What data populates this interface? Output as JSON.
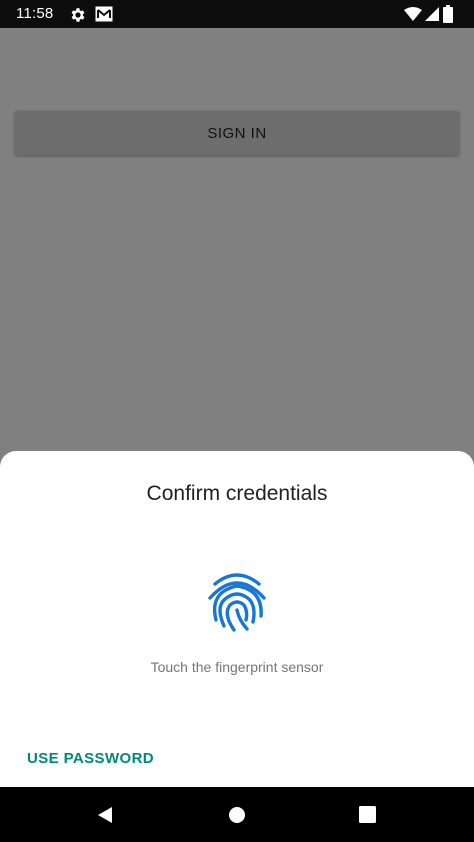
{
  "status_bar": {
    "time": "11:58",
    "icons": [
      "gear-icon",
      "mail-icon",
      "wifi-icon",
      "signal-icon",
      "battery-icon"
    ]
  },
  "app": {
    "sign_in_label": "SIGN IN"
  },
  "dialog": {
    "title": "Confirm credentials",
    "icon": "fingerprint-icon",
    "hint": "Touch the fingerprint sensor",
    "use_password_label": "USE PASSWORD",
    "accent_color": "#00897b",
    "fingerprint_color": "#1976d2"
  },
  "nav_bar": {
    "icons": [
      "back-icon",
      "home-icon",
      "recents-icon"
    ]
  }
}
